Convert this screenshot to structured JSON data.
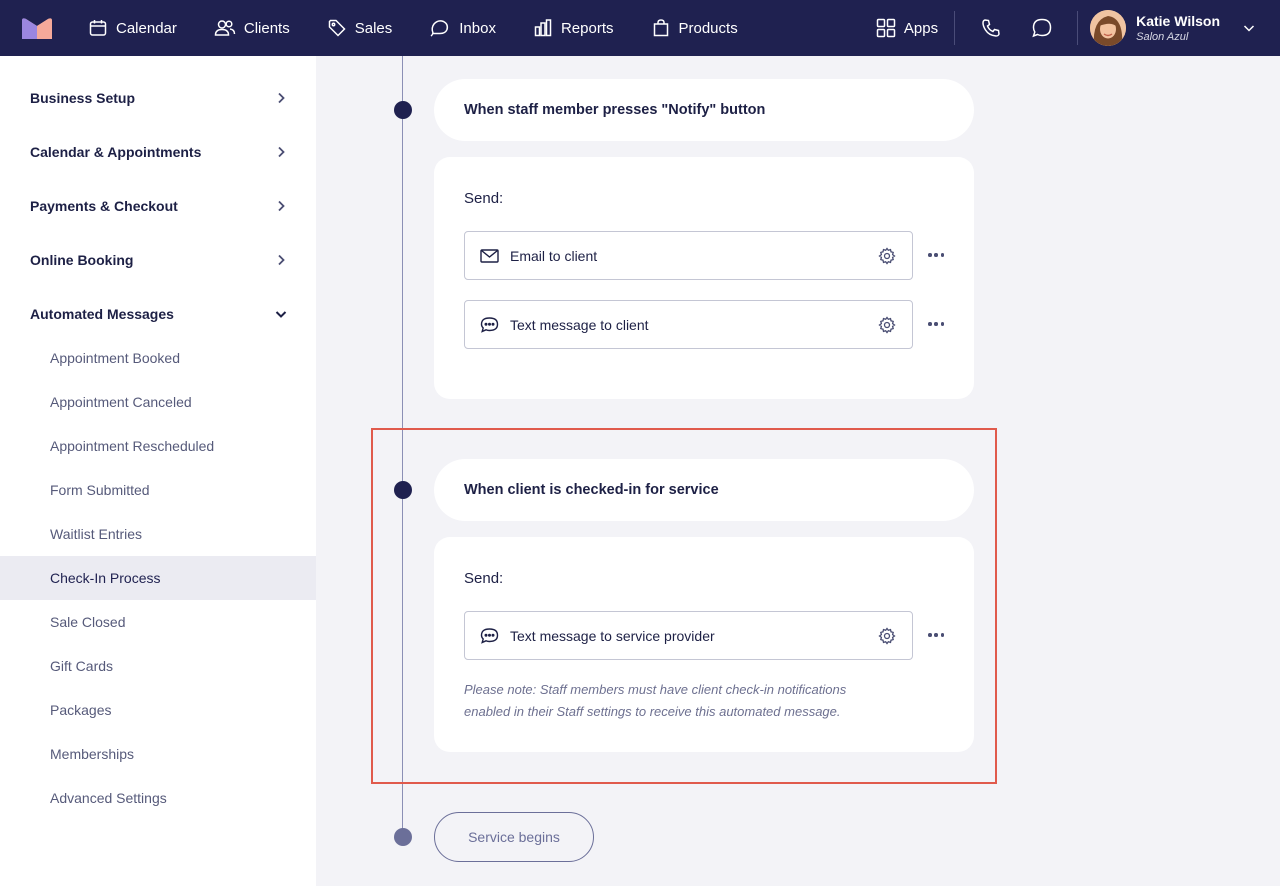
{
  "topnav": {
    "items": [
      {
        "label": "Calendar",
        "icon": "calendar-icon"
      },
      {
        "label": "Clients",
        "icon": "users-icon"
      },
      {
        "label": "Sales",
        "icon": "tag-icon"
      },
      {
        "label": "Inbox",
        "icon": "inbox-icon"
      },
      {
        "label": "Reports",
        "icon": "chart-icon"
      },
      {
        "label": "Products",
        "icon": "shopping-bag-icon"
      }
    ],
    "apps_label": "Apps",
    "user": {
      "name": "Katie Wilson",
      "business": "Salon Azul"
    }
  },
  "sidebar": {
    "sections": [
      {
        "label": "Business Setup",
        "expanded": false
      },
      {
        "label": "Calendar & Appointments",
        "expanded": false
      },
      {
        "label": "Payments & Checkout",
        "expanded": false
      },
      {
        "label": "Online Booking",
        "expanded": false
      },
      {
        "label": "Automated Messages",
        "expanded": true
      }
    ],
    "subitems": [
      "Appointment Booked",
      "Appointment Canceled",
      "Appointment Rescheduled",
      "Form Submitted",
      "Waitlist Entries",
      "Check-In Process",
      "Sale Closed",
      "Gift Cards",
      "Packages",
      "Memberships",
      "Advanced Settings"
    ],
    "active_item": "Check-In Process"
  },
  "timeline": {
    "event1": {
      "title": "When staff member presses \"Notify\" button",
      "send_label": "Send:",
      "messages": [
        {
          "label": "Email to client",
          "icon": "envelope-icon"
        },
        {
          "label": "Text message to client",
          "icon": "chat-bubble-icon"
        }
      ]
    },
    "event2": {
      "title": "When client is checked-in for service",
      "send_label": "Send:",
      "messages": [
        {
          "label": "Text message to service provider",
          "icon": "chat-bubble-icon"
        }
      ],
      "note_line1": "Please note: Staff members must have client check-in notifications",
      "note_line2": "enabled in their Staff settings to receive this automated message."
    },
    "end_label": "Service begins"
  },
  "colors": {
    "navbar": "#1f2150",
    "highlight": "#e05a4c",
    "active_bg": "#ebebf2"
  }
}
